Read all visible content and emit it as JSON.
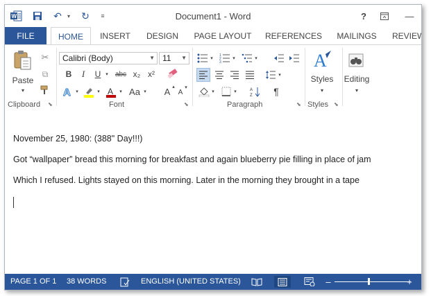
{
  "window": {
    "title": "Document1 - Word",
    "help": "?",
    "restore": "⧉",
    "minimize": "—"
  },
  "quick_access": {
    "save": "💾",
    "undo": "↶",
    "redo": "↻",
    "customize": "⩡"
  },
  "tabs": [
    {
      "label": "FILE"
    },
    {
      "label": "HOME"
    },
    {
      "label": "INSERT"
    },
    {
      "label": "DESIGN"
    },
    {
      "label": "PAGE LAYOUT"
    },
    {
      "label": "REFERENCES"
    },
    {
      "label": "MAILINGS"
    },
    {
      "label": "REVIEW"
    }
  ],
  "ribbon": {
    "clipboard": {
      "label": "Clipboard",
      "paste": "Paste"
    },
    "font": {
      "label": "Font",
      "font_name": "Calibri (Body)",
      "font_size": "11",
      "bold": "B",
      "italic": "I",
      "underline": "U",
      "strike": "abc",
      "subscript": "x₂",
      "superscript": "x²",
      "change_case": "Aa",
      "grow": "A",
      "shrink": "A"
    },
    "paragraph": {
      "label": "Paragraph",
      "show_marks": "¶"
    },
    "styles": {
      "label": "Styles",
      "button": "Styles"
    },
    "editing": {
      "button": "Editing"
    }
  },
  "document": {
    "lines": [
      "November 25, 1980: (388\" Day!!!)",
      "Got “wallpaper” bread this morning for breakfast and again blueberry pie filling in place of jam",
      "Which I refused. Lights stayed on this morning. Later in the morning they brought in a tape"
    ]
  },
  "status": {
    "page": "PAGE 1 OF 1",
    "words": "38 WORDS",
    "language": "ENGLISH (UNITED STATES)",
    "zoom_minus": "–",
    "zoom_plus": "+"
  },
  "colors": {
    "accent": "#2b579a",
    "highlight": "#ffff00",
    "font_color": "#c00000"
  }
}
